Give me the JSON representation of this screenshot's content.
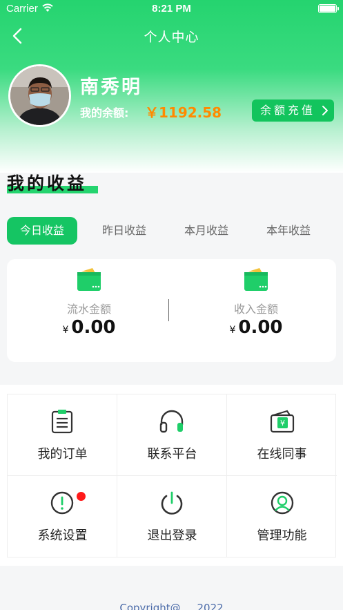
{
  "status_bar": {
    "carrier": "Carrier",
    "time": "8:21 PM"
  },
  "nav": {
    "title": "个人中心"
  },
  "profile": {
    "name": "南秀明",
    "balance_label": "我的余额:",
    "balance_value": "￥1192.58",
    "recharge_label": "余额充值"
  },
  "earnings": {
    "section_title": "我的收益",
    "tabs": [
      {
        "label": "今日收益",
        "active": true
      },
      {
        "label": "昨日收益",
        "active": false
      },
      {
        "label": "本月收益",
        "active": false
      },
      {
        "label": "本年收益",
        "active": false
      }
    ],
    "items": [
      {
        "label": "流水金额",
        "currency": "¥",
        "value": "0.00"
      },
      {
        "label": "收入金额",
        "currency": "¥",
        "value": "0.00"
      }
    ]
  },
  "menu": {
    "items": [
      {
        "label": "我的订单",
        "icon": "clipboard-icon"
      },
      {
        "label": "联系平台",
        "icon": "headset-icon"
      },
      {
        "label": "在线同事",
        "icon": "wallet-icon"
      },
      {
        "label": "系统设置",
        "icon": "alert-icon",
        "badge": true
      },
      {
        "label": "退出登录",
        "icon": "power-icon"
      },
      {
        "label": "管理功能",
        "icon": "user-icon"
      }
    ]
  },
  "footer": {
    "text": "Copyright@ ... 2022"
  },
  "colors": {
    "brand_green": "#25d46f",
    "active_tab": "#15c563",
    "balance_orange": "#ff8a00",
    "badge_red": "#ff1a1a"
  }
}
